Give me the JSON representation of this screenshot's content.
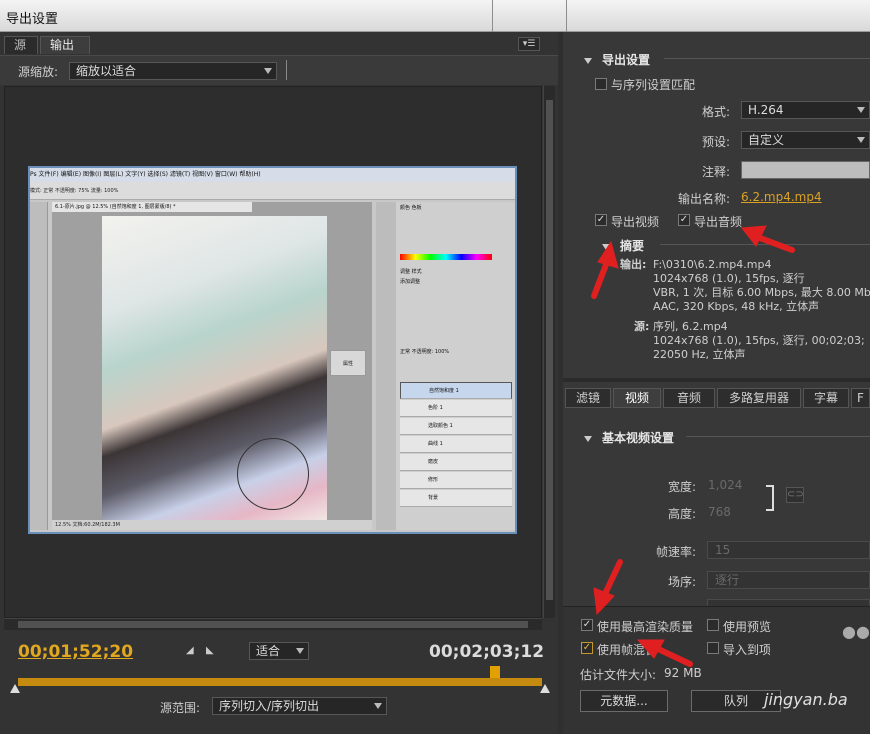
{
  "window": {
    "title": "导出设置"
  },
  "left": {
    "tabs": [
      {
        "label": "源"
      },
      {
        "label": "输出"
      }
    ],
    "source_scale_label": "源缩放:",
    "source_scale_value": "缩放以适合",
    "preview": {
      "ps_menu": "Ps  文件(F)  编辑(E)  图像(I)  图层(L)  文字(Y)  选择(S)  滤镜(T)  视图(V)  窗口(W)  帮助(H)",
      "ps_options": "模式: 正常   不透明度: 75%   流量: 100%",
      "ps_doc_tab": "6.1-原片.jpg @ 12.5% (自然饱和度 1, 图层蒙版/8) *",
      "ps_status": "12.5%    文档:60.2M/182.3M",
      "ps_layers_header": "正常   不透明度: 100%",
      "ps_layers": [
        {
          "name": "自然饱和度 1",
          "selected": true
        },
        {
          "name": "色阶 1"
        },
        {
          "name": "选取颜色 1"
        },
        {
          "name": "曲线 1"
        },
        {
          "name": "磨皮"
        },
        {
          "name": "修形"
        },
        {
          "name": "背景"
        }
      ],
      "ps_panel_tab_color": "颜色   色板",
      "ps_panel_tab_adjust": "调整   样式",
      "ps_panel_add_adjust": "添加调整",
      "ps_float_label": "属性"
    },
    "timecode_current": "00;01;52;20",
    "timecode_duration": "00;02;03;12",
    "fit_value": "适合",
    "source_range_label": "源范围:",
    "source_range_value": "序列切入/序列切出",
    "playhead_fraction": 0.91
  },
  "right": {
    "export_settings": {
      "title": "导出设置",
      "match_sequence": "与序列设置匹配",
      "format_label": "格式:",
      "format_value": "H.264",
      "preset_label": "预设:",
      "preset_value": "自定义",
      "comment_label": "注释:",
      "output_name_label": "输出名称:",
      "output_name_value": "6.2.mp4.mp4",
      "export_video": "导出视频",
      "export_audio": "导出音频"
    },
    "summary": {
      "title": "摘要",
      "output_label": "输出:",
      "output_lines": [
        "F:\\0310\\6.2.mp4.mp4",
        "1024x768 (1.0), 15fps, 逐行",
        "VBR, 1 次, 目标 6.00 Mbps, 最大 8.00 Mb",
        "AAC, 320 Kbps, 48 kHz, 立体声"
      ],
      "source_label": "源:",
      "source_lines": [
        "序列, 6.2.mp4",
        "1024x768 (1.0), 15fps, 逐行, 00;02;03;",
        "22050 Hz, 立体声"
      ]
    },
    "tabs": [
      {
        "label": "滤镜"
      },
      {
        "label": "视频",
        "active": true
      },
      {
        "label": "音频"
      },
      {
        "label": "多路复用器"
      },
      {
        "label": "字幕"
      },
      {
        "label": "F"
      }
    ],
    "video": {
      "section_title": "基本视频设置",
      "width_label": "宽度:",
      "width_value": "1,024",
      "height_label": "高度:",
      "height_value": "768",
      "framerate_label": "帧速率:",
      "framerate_value": "15",
      "field_order_label": "场序:",
      "field_order_value": "逐行"
    },
    "bottom": {
      "max_render_quality": "使用最高渲染质量",
      "use_preview": "使用预览",
      "use_frame_blending": "使用帧混合",
      "import_to": "导入到项目",
      "estimated_size_label": "估计文件大小:",
      "estimated_size_value": "92 MB",
      "metadata_button": "元数据...",
      "queue_button": "队列"
    }
  },
  "watermark": "jingyan.ba",
  "colors": {
    "timecode": "#e0a820",
    "annotation_arrow": "#e02020",
    "link": "#d9a126"
  }
}
